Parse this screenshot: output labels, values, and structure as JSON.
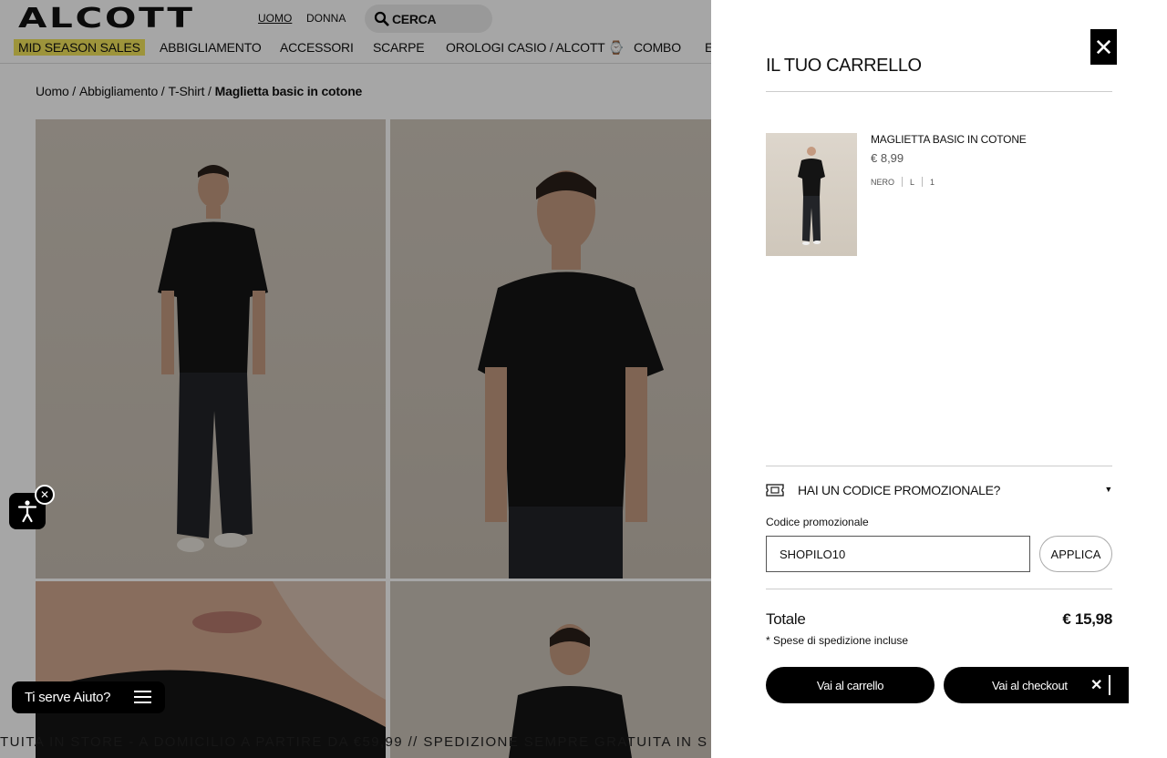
{
  "header": {
    "logo": "ALCOTT",
    "gender_uomo": "UOMO",
    "gender_donna": "DONNA",
    "search_label": "CERCA",
    "nav": [
      "MID SEASON SALES",
      "ABBIGLIAMENTO",
      "ACCESSORI",
      "SCARPE",
      "OROLOGI CASIO / ALCOTT ⌚",
      "COMBO",
      "E"
    ]
  },
  "breadcrumb": {
    "items": [
      "Uomo /",
      "Abbigliamento /",
      "T-Shirt /"
    ],
    "current": "Maglietta basic in cotone"
  },
  "ticker": "TUITA IN STORE - A DOMICILIO A PARTIRE DA €59,99 //  SPEDIZIONE SEMPRE GRATUITA IN S",
  "help": {
    "label": "Ti serve Aiuto?"
  },
  "cart": {
    "title": "IL TUO CARRELLO",
    "close_symbol": "✕",
    "item": {
      "name": "MAGLIETTA BASIC IN COTONE",
      "price": "€ 8,99",
      "color": "NERO",
      "size": "L",
      "quantity": "1"
    },
    "promo": {
      "toggle_label": "HAI UN CODICE PROMOZIONALE?",
      "field_label": "Codice promozionale",
      "value": "SHOPILO10",
      "apply_label": "APPLICA"
    },
    "total_label": "Totale",
    "total_value": "€ 15,98",
    "shipping_note": "* Spese di spedizione incluse",
    "btn_cart": "Vai al carrello",
    "btn_checkout": "Vai al checkout"
  },
  "colors": {
    "sale_highlight": "#f1e35b",
    "primary": "#000000",
    "overlay": "rgba(0,0,0,0.35)"
  }
}
